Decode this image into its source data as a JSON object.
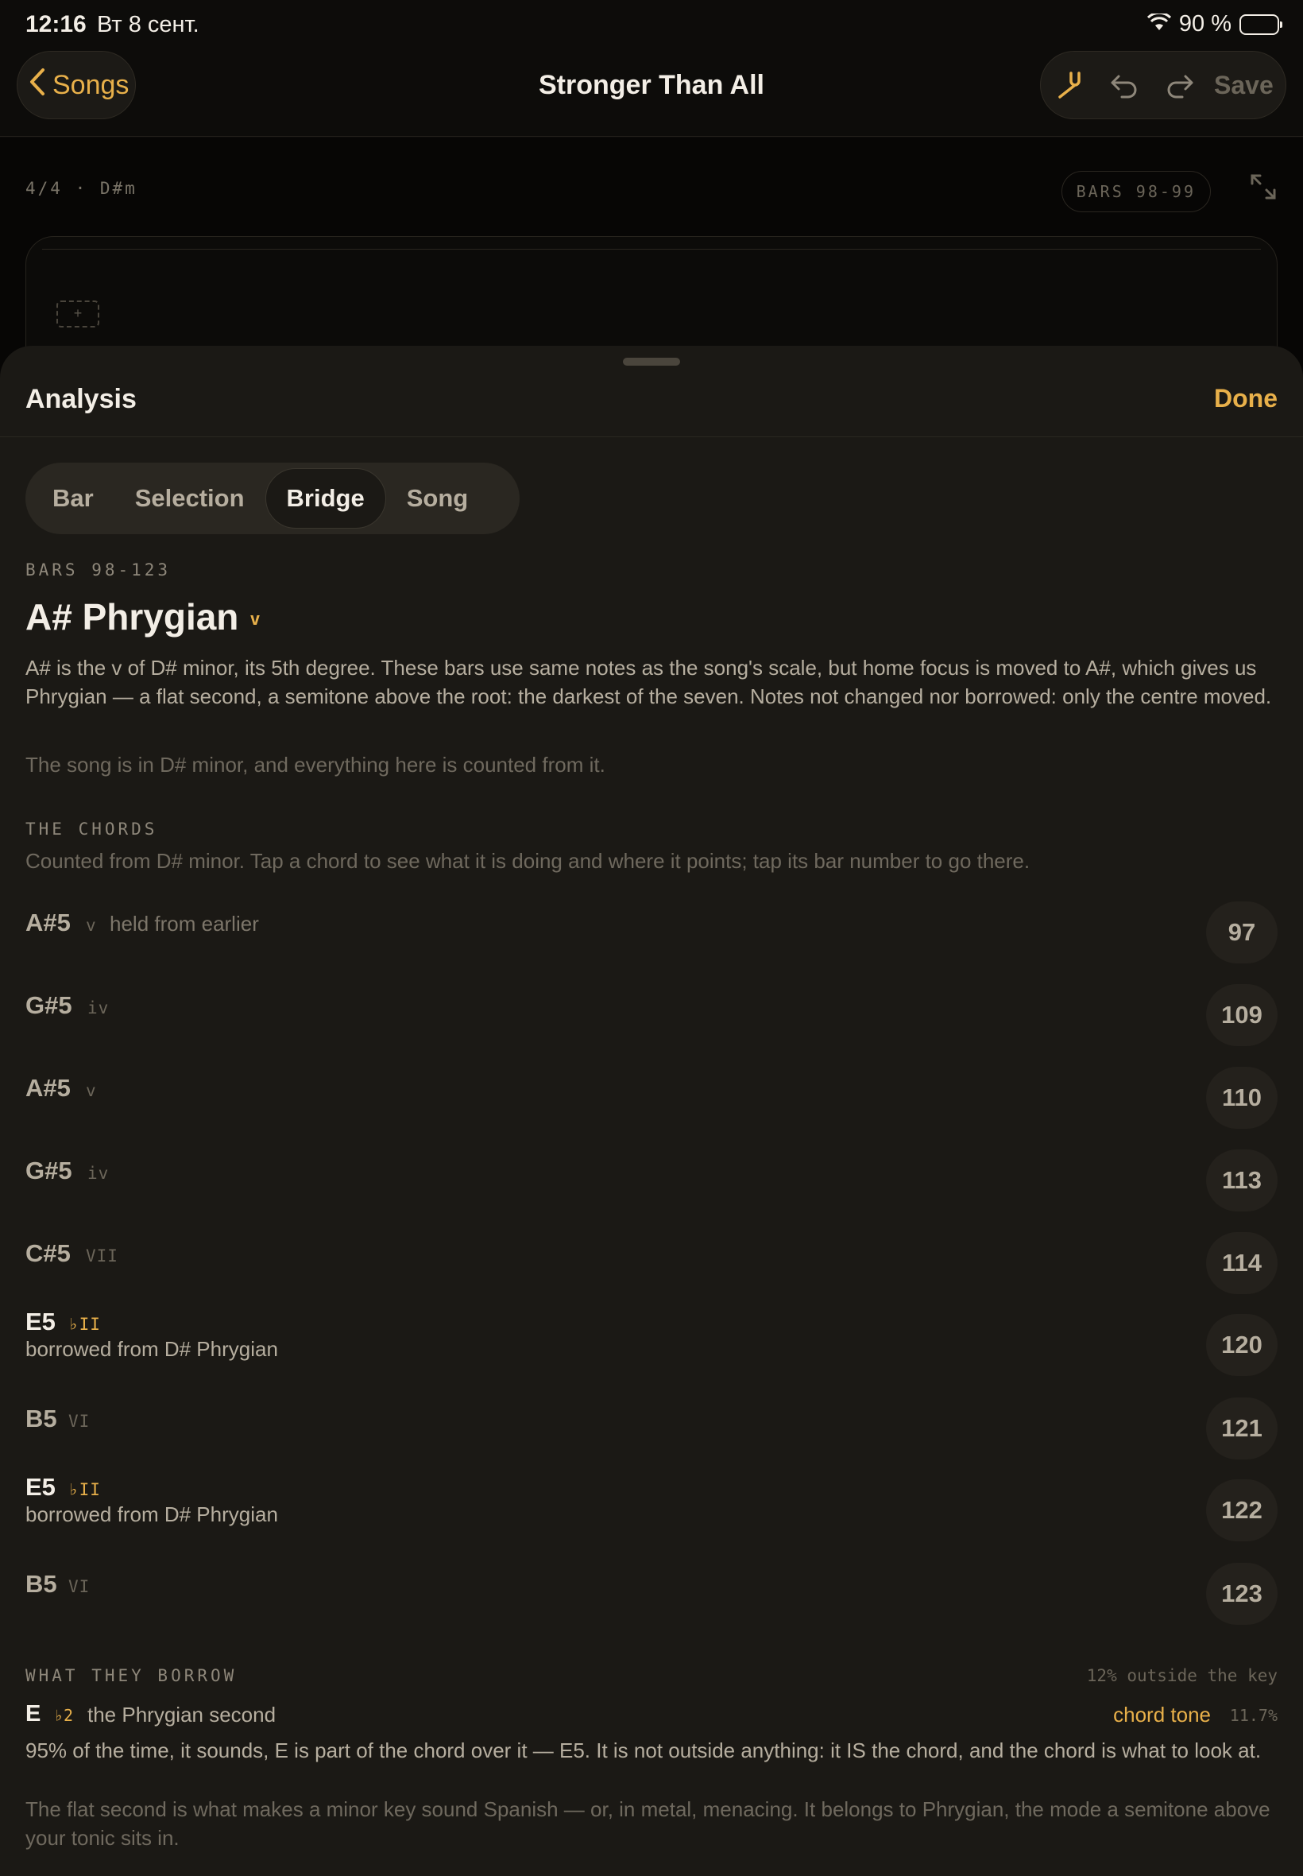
{
  "status": {
    "time": "12:16",
    "date": "Вт 8 сент.",
    "battery": "90 %"
  },
  "nav": {
    "back_label": "Songs",
    "title": "Stronger Than All",
    "save_label": "Save"
  },
  "editor": {
    "meta": "4/4 · D#m",
    "bars_range": "BARS 98-99",
    "add_label": "+"
  },
  "sheet": {
    "title": "Analysis",
    "done_label": "Done",
    "tabs": [
      "Bar",
      "Selection",
      "Bridge",
      "Song"
    ],
    "active_tab": "Bridge",
    "bars_label": "BARS 98-123",
    "mode_title": "A# Phrygian",
    "mode_degree": "v",
    "description": "A# is the v of D# minor, its 5th degree. These bars use same notes as the song's scale, but home focus is moved to A#, which gives us Phrygian — a flat second, a semitone above the root: the darkest of the seven. Notes not changed nor borrowed: only the centre moved.",
    "key_note": "The song is in D# minor, and everything here is counted from it.",
    "chords_heading": "THE CHORDS",
    "chords_sub": "Counted from D# minor. Tap a chord to see what it is doing and where it points; tap its bar number to go there.",
    "chords": [
      {
        "name": "A#5",
        "numeral": "v",
        "note": "held from earlier",
        "bar": "97",
        "borrowed": false
      },
      {
        "name": "G#5",
        "numeral": "iv",
        "note": "",
        "bar": "109",
        "borrowed": false
      },
      {
        "name": "A#5",
        "numeral": "v",
        "note": "",
        "bar": "110",
        "borrowed": false
      },
      {
        "name": "G#5",
        "numeral": "iv",
        "note": "",
        "bar": "113",
        "borrowed": false
      },
      {
        "name": "C#5",
        "numeral": "VII",
        "note": "",
        "bar": "114",
        "borrowed": false
      },
      {
        "name": "E5",
        "numeral": "♭II",
        "note": "borrowed from D# Phrygian",
        "bar": "120",
        "borrowed": true
      },
      {
        "name": "B5",
        "numeral": "VI",
        "note": "",
        "bar": "121",
        "borrowed": false
      },
      {
        "name": "E5",
        "numeral": "♭II",
        "note": "borrowed from D# Phrygian",
        "bar": "122",
        "borrowed": true
      },
      {
        "name": "B5",
        "numeral": "VI",
        "note": "",
        "bar": "123",
        "borrowed": false
      }
    ],
    "borrow_heading": "WHAT THEY BORROW",
    "borrow_outside": "12% outside the key",
    "borrow": {
      "note": "E",
      "degree": "♭2",
      "label": "the Phrygian second",
      "role": "chord tone",
      "percent": "11.7%",
      "explain": "95% of the time, it sounds, E is part of the chord over it — E5. It is not outside anything: it IS the chord, and the chord is what to look at.",
      "detail": "The flat second is what makes a minor key sound Spanish — or, in metal, menacing. It belongs to Phrygian, the mode a semitone above your tonic sits in."
    }
  },
  "colors": {
    "accent": "#e8b04a",
    "background": "#1b1915",
    "muted": "#8e877a"
  }
}
